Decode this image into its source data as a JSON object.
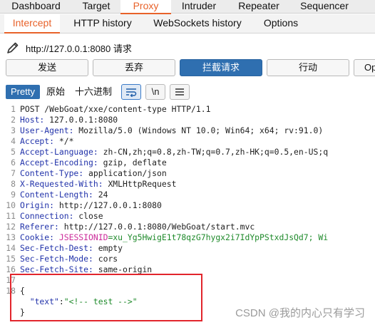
{
  "top_tabs": [
    "Dashboard",
    "Target",
    "Proxy",
    "Intruder",
    "Repeater",
    "Sequencer"
  ],
  "sub_tabs": [
    "Intercept",
    "HTTP history",
    "WebSockets history",
    "Options"
  ],
  "request_url": "http://127.0.0.1:8080 请求",
  "actions": [
    "发送",
    "丢弃",
    "拦截请求",
    "行动",
    "Op"
  ],
  "editor_tabs": [
    "Pretty",
    "原始",
    "十六进制"
  ],
  "editor_icons": [
    "wrap-lines-icon",
    "newline-icon",
    "menu-icon"
  ],
  "editor_newline_label": "\\n",
  "colors": {
    "accent": "#e8622a",
    "primary_button": "#2f6fb0",
    "highlight_box": "#e2252c"
  },
  "code_lines": [
    {
      "num": "1",
      "text": "POST /WebGoat/xxe/content-type HTTP/1.1"
    },
    {
      "num": "2",
      "key": "Host:",
      "value": " 127.0.0.1:8080"
    },
    {
      "num": "3",
      "key": "User-Agent:",
      "value": " Mozilla/5.0 (Windows NT 10.0; Win64; x64; rv:91.0)"
    },
    {
      "num": "4",
      "key": "Accept:",
      "value": " */*"
    },
    {
      "num": "5",
      "key": "Accept-Language:",
      "value": " zh-CN,zh;q=0.8,zh-TW;q=0.7,zh-HK;q=0.5,en-US;q"
    },
    {
      "num": "6",
      "key": "Accept-Encoding:",
      "value": " gzip, deflate"
    },
    {
      "num": "7",
      "key": "Content-Type:",
      "value": " application/json"
    },
    {
      "num": "8",
      "key": "X-Requested-With:",
      "value": " XMLHttpRequest"
    },
    {
      "num": "9",
      "key": "Content-Length:",
      "value": " 24"
    },
    {
      "num": "10",
      "key": "Origin:",
      "value": " http://127.0.0.1:8080"
    },
    {
      "num": "11",
      "key": "Connection:",
      "value": " close"
    },
    {
      "num": "12",
      "key": "Referer:",
      "value": " http://127.0.0.1:8080/WebGoat/start.mvc"
    },
    {
      "num": "13",
      "key": "Cookie:",
      "cookie_name": " JSESSIONID",
      "cookie_value": "=xu_Yg5HwigE1t78qzG7hygx2i7IdYpPStxdJsQd7; Wi"
    },
    {
      "num": "14",
      "key": "Sec-Fetch-Dest:",
      "value": " empty"
    },
    {
      "num": "15",
      "key": "Sec-Fetch-Mode:",
      "value": " cors"
    },
    {
      "num": "16",
      "key": "Sec-Fetch-Site:",
      "value": " same-origin"
    },
    {
      "num": "17",
      "text": ""
    },
    {
      "num": "18",
      "text": "{"
    },
    {
      "num": "",
      "json_key": "  \"text\"",
      "json_sep": ":",
      "json_value": "\"<!-- test -->\""
    },
    {
      "num": "",
      "text": "}"
    }
  ],
  "watermark": "CSDN @我的内心只有学习"
}
